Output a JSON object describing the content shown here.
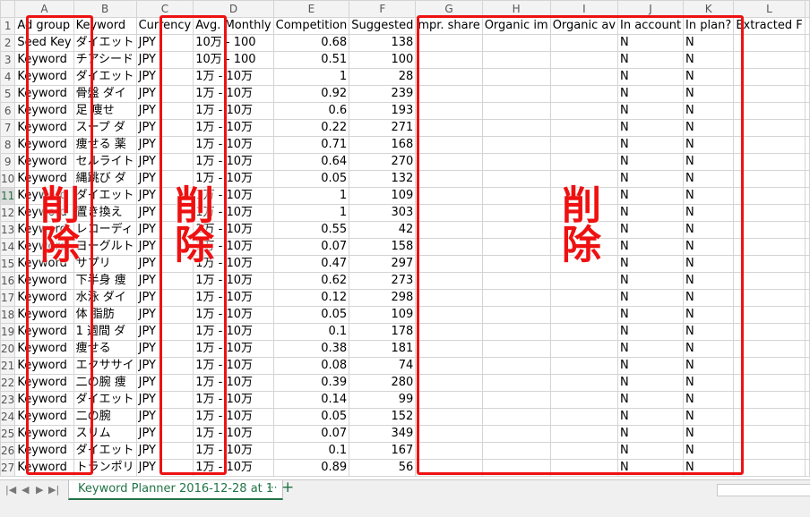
{
  "columns": [
    "A",
    "B",
    "C",
    "D",
    "E",
    "F",
    "G",
    "H",
    "I",
    "J",
    "K",
    "L"
  ],
  "headers": [
    "Ad group",
    "Keyword",
    "Currency",
    "Avg. Monthly",
    "Competition",
    "Suggested",
    "mpr. share",
    "Organic im",
    "Organic av",
    "In account",
    "In plan?",
    "Extracted F"
  ],
  "rows": [
    [
      "Seed Key",
      "ダイエット",
      "JPY",
      "10万 - 100",
      "0.68",
      "138",
      "",
      "",
      "",
      "N",
      "N"
    ],
    [
      "Keyword",
      "チアシード",
      "JPY",
      "10万 - 100",
      "0.51",
      "100",
      "",
      "",
      "",
      "N",
      "N"
    ],
    [
      "Keyword",
      "ダイエット",
      "JPY",
      "1万 - 10万",
      "1",
      "28",
      "",
      "",
      "",
      "N",
      "N"
    ],
    [
      "Keyword",
      "骨盤 ダイ",
      "JPY",
      "1万 - 10万",
      "0.92",
      "239",
      "",
      "",
      "",
      "N",
      "N"
    ],
    [
      "Keyword",
      "足 痩せ",
      "JPY",
      "1万 - 10万",
      "0.6",
      "193",
      "",
      "",
      "",
      "N",
      "N"
    ],
    [
      "Keyword",
      "スープ ダ",
      "JPY",
      "1万 - 10万",
      "0.22",
      "271",
      "",
      "",
      "",
      "N",
      "N"
    ],
    [
      "Keyword",
      "痩せる 薬",
      "JPY",
      "1万 - 10万",
      "0.71",
      "168",
      "",
      "",
      "",
      "N",
      "N"
    ],
    [
      "Keyword",
      "セルライト",
      "JPY",
      "1万 - 10万",
      "0.64",
      "270",
      "",
      "",
      "",
      "N",
      "N"
    ],
    [
      "Keyword",
      "縄跳び ダ",
      "JPY",
      "1万 - 10万",
      "0.05",
      "132",
      "",
      "",
      "",
      "N",
      "N"
    ],
    [
      "Keyword",
      "ダイエット",
      "JPY",
      "1万 - 10万",
      "1",
      "109",
      "",
      "",
      "",
      "N",
      "N"
    ],
    [
      "Keyword",
      "置き換え",
      "JPY",
      "1万 - 10万",
      "1",
      "303",
      "",
      "",
      "",
      "N",
      "N"
    ],
    [
      "Keyword",
      "レコーディ",
      "JPY",
      "1万 - 10万",
      "0.55",
      "42",
      "",
      "",
      "",
      "N",
      "N"
    ],
    [
      "Keyword",
      "ヨーグルト",
      "JPY",
      "1万 - 10万",
      "0.07",
      "158",
      "",
      "",
      "",
      "N",
      "N"
    ],
    [
      "Keyword",
      "サプリ",
      "JPY",
      "1万 - 10万",
      "0.47",
      "297",
      "",
      "",
      "",
      "N",
      "N"
    ],
    [
      "Keyword",
      "下半身 痩",
      "JPY",
      "1万 - 10万",
      "0.62",
      "273",
      "",
      "",
      "",
      "N",
      "N"
    ],
    [
      "Keyword",
      "水泳 ダイ",
      "JPY",
      "1万 - 10万",
      "0.12",
      "298",
      "",
      "",
      "",
      "N",
      "N"
    ],
    [
      "Keyword",
      "体 脂肪",
      "JPY",
      "1万 - 10万",
      "0.05",
      "109",
      "",
      "",
      "",
      "N",
      "N"
    ],
    [
      "Keyword",
      "1 週間 ダ",
      "JPY",
      "1万 - 10万",
      "0.1",
      "178",
      "",
      "",
      "",
      "N",
      "N"
    ],
    [
      "Keyword",
      "痩せる",
      "JPY",
      "1万 - 10万",
      "0.38",
      "181",
      "",
      "",
      "",
      "N",
      "N"
    ],
    [
      "Keyword",
      "エクササイ",
      "JPY",
      "1万 - 10万",
      "0.08",
      "74",
      "",
      "",
      "",
      "N",
      "N"
    ],
    [
      "Keyword",
      "二の腕 痩",
      "JPY",
      "1万 - 10万",
      "0.39",
      "280",
      "",
      "",
      "",
      "N",
      "N"
    ],
    [
      "Keyword",
      "ダイエット",
      "JPY",
      "1万 - 10万",
      "0.14",
      "99",
      "",
      "",
      "",
      "N",
      "N"
    ],
    [
      "Keyword",
      "二の腕",
      "JPY",
      "1万 - 10万",
      "0.05",
      "152",
      "",
      "",
      "",
      "N",
      "N"
    ],
    [
      "Keyword",
      "スリム",
      "JPY",
      "1万 - 10万",
      "0.07",
      "349",
      "",
      "",
      "",
      "N",
      "N"
    ],
    [
      "Keyword",
      "ダイエット",
      "JPY",
      "1万 - 10万",
      "0.1",
      "167",
      "",
      "",
      "",
      "N",
      "N"
    ],
    [
      "Keyword",
      "トランポリ",
      "JPY",
      "1万 - 10万",
      "0.89",
      "56",
      "",
      "",
      "",
      "N",
      "N"
    ]
  ],
  "selected_row": 11,
  "annotation_text": "削除",
  "annotation_color": "#ee1111",
  "sheet_tab": "Keyword Planner 2016-12-28 at 1",
  "tab_more": "···",
  "add_sheet": "+",
  "nav": [
    "|◀",
    "◀",
    "▶",
    "▶|"
  ]
}
